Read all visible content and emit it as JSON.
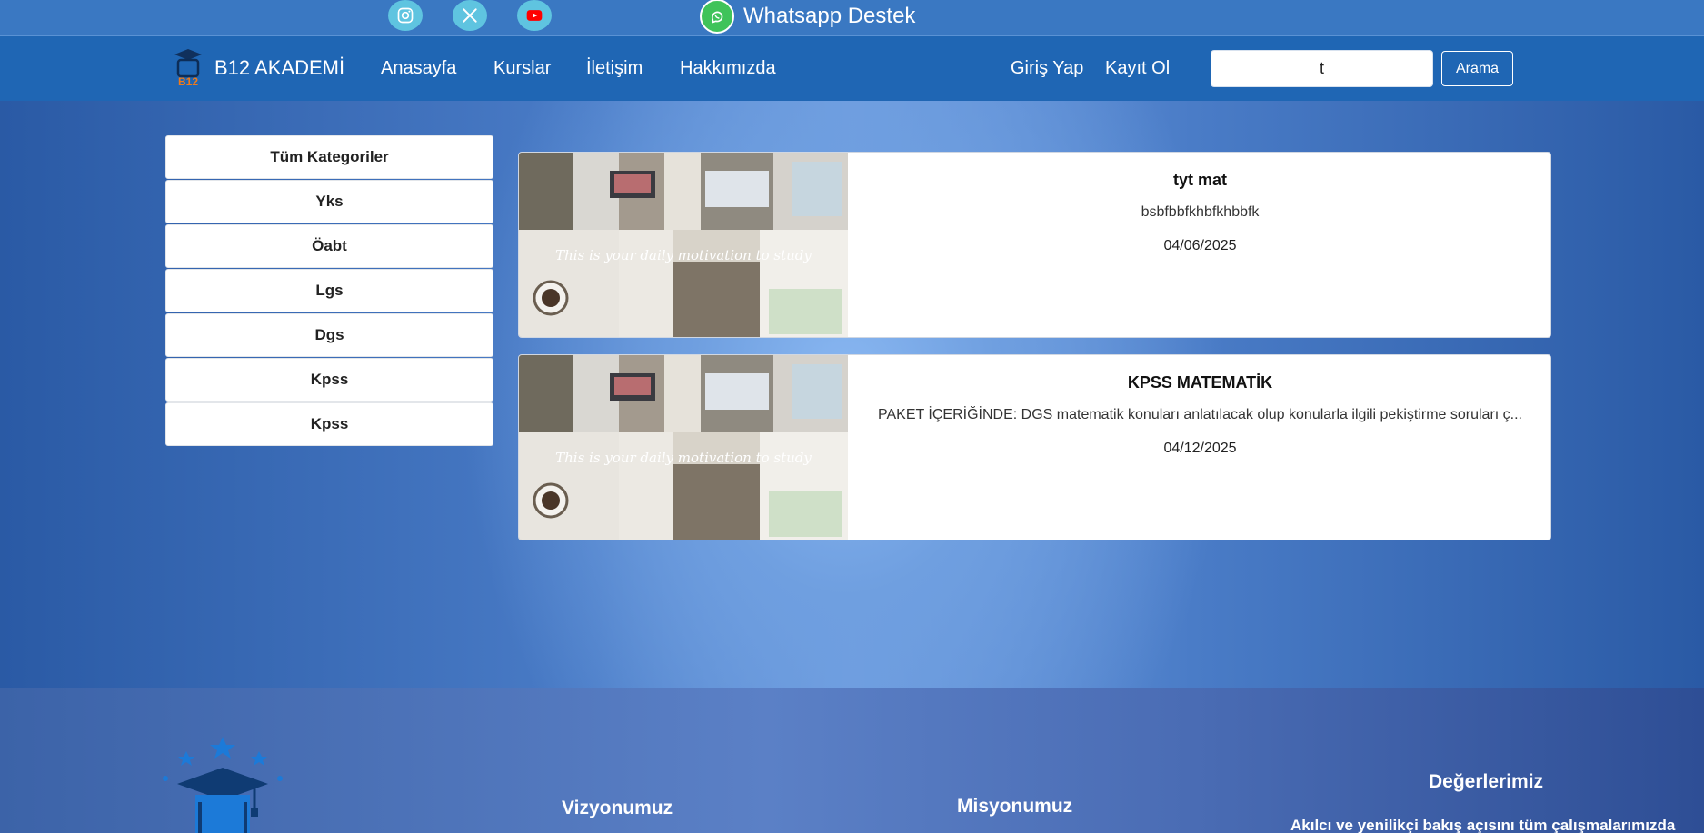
{
  "topbar": {
    "social": [
      {
        "name": "instagram-icon"
      },
      {
        "name": "x-twitter-icon"
      },
      {
        "name": "youtube-icon"
      }
    ],
    "whatsapp_label": "Whatsapp Destek"
  },
  "nav": {
    "brand": "B12 AKADEMİ",
    "logo_text": "B12",
    "links": [
      "Anasayfa",
      "Kurslar",
      "İletişim",
      "Hakkımızda"
    ],
    "login": "Giriş Yap",
    "register": "Kayıt Ol",
    "search_value": "t",
    "search_button": "Arama"
  },
  "categories": [
    "Tüm Kategoriler",
    "Yks",
    "Öabt",
    "Lgs",
    "Dgs",
    "Kpss",
    "Kpss"
  ],
  "courses": [
    {
      "title": "tyt mat",
      "description": "bsbfbbfkhbfkhbbfk",
      "date": "04/06/2025",
      "image_caption": "This is your daily motivation to study"
    },
    {
      "title": "KPSS MATEMATİK",
      "description": "PAKET İÇERİĞİNDE: DGS matematik konuları anlatılacak olup konularla ilgili pekiştirme soruları ç...",
      "date": "04/12/2025",
      "image_caption": "This is your daily motivation to study"
    }
  ],
  "footer": {
    "vision": "Vizyonumuz",
    "mission": "Misyonumuz",
    "values": "Değerlerimiz",
    "values_text": "Akılcı ve yenilikçi bakış açısını tüm çalışmalarımızda"
  },
  "colors": {
    "topbar": "#3a78c2",
    "navbar": "#1f66b4",
    "social_bg": "#5fc4e0",
    "whatsapp": "#3fc35a",
    "youtube": "#ff0000"
  }
}
